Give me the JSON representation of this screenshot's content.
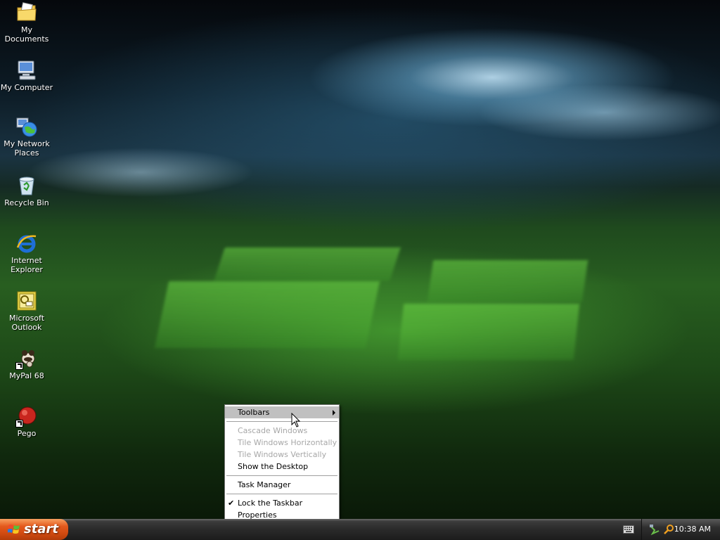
{
  "desktop_icons": [
    {
      "label": "My Documents",
      "icon": "folder-documents-icon"
    },
    {
      "label": "My Computer",
      "icon": "computer-icon"
    },
    {
      "label": "My Network Places",
      "icon": "network-globe-icon"
    },
    {
      "label": "Recycle Bin",
      "icon": "recycle-bin-icon"
    },
    {
      "label": "Internet Explorer",
      "icon": "internet-explorer-icon"
    },
    {
      "label": "Microsoft Outlook",
      "icon": "outlook-icon"
    },
    {
      "label": "MyPal 68",
      "icon": "mypal-icon"
    },
    {
      "label": "Pego",
      "icon": "pego-icon"
    }
  ],
  "context_menu": {
    "items": [
      {
        "label": "Toolbars",
        "state": "highlighted",
        "submenu": true
      },
      {
        "label": "Cascade Windows",
        "state": "disabled"
      },
      {
        "label": "Tile Windows Horizontally",
        "state": "disabled"
      },
      {
        "label": "Tile Windows Vertically",
        "state": "disabled"
      },
      {
        "label": "Show the Desktop",
        "state": "enabled"
      },
      {
        "label": "Task Manager",
        "state": "enabled"
      },
      {
        "label": "Lock the Taskbar",
        "state": "checked"
      },
      {
        "label": "Properties",
        "state": "enabled"
      }
    ]
  },
  "taskbar": {
    "start_label": "start",
    "clock": "10:38 AM",
    "tray_icons": [
      "keyboard-icon",
      "network-icon",
      "search-icon"
    ]
  },
  "colors": {
    "start_orange": "#e4591c",
    "taskbar_dark": "#2a2a2a",
    "menu_highlight": "#c0c0c0"
  }
}
